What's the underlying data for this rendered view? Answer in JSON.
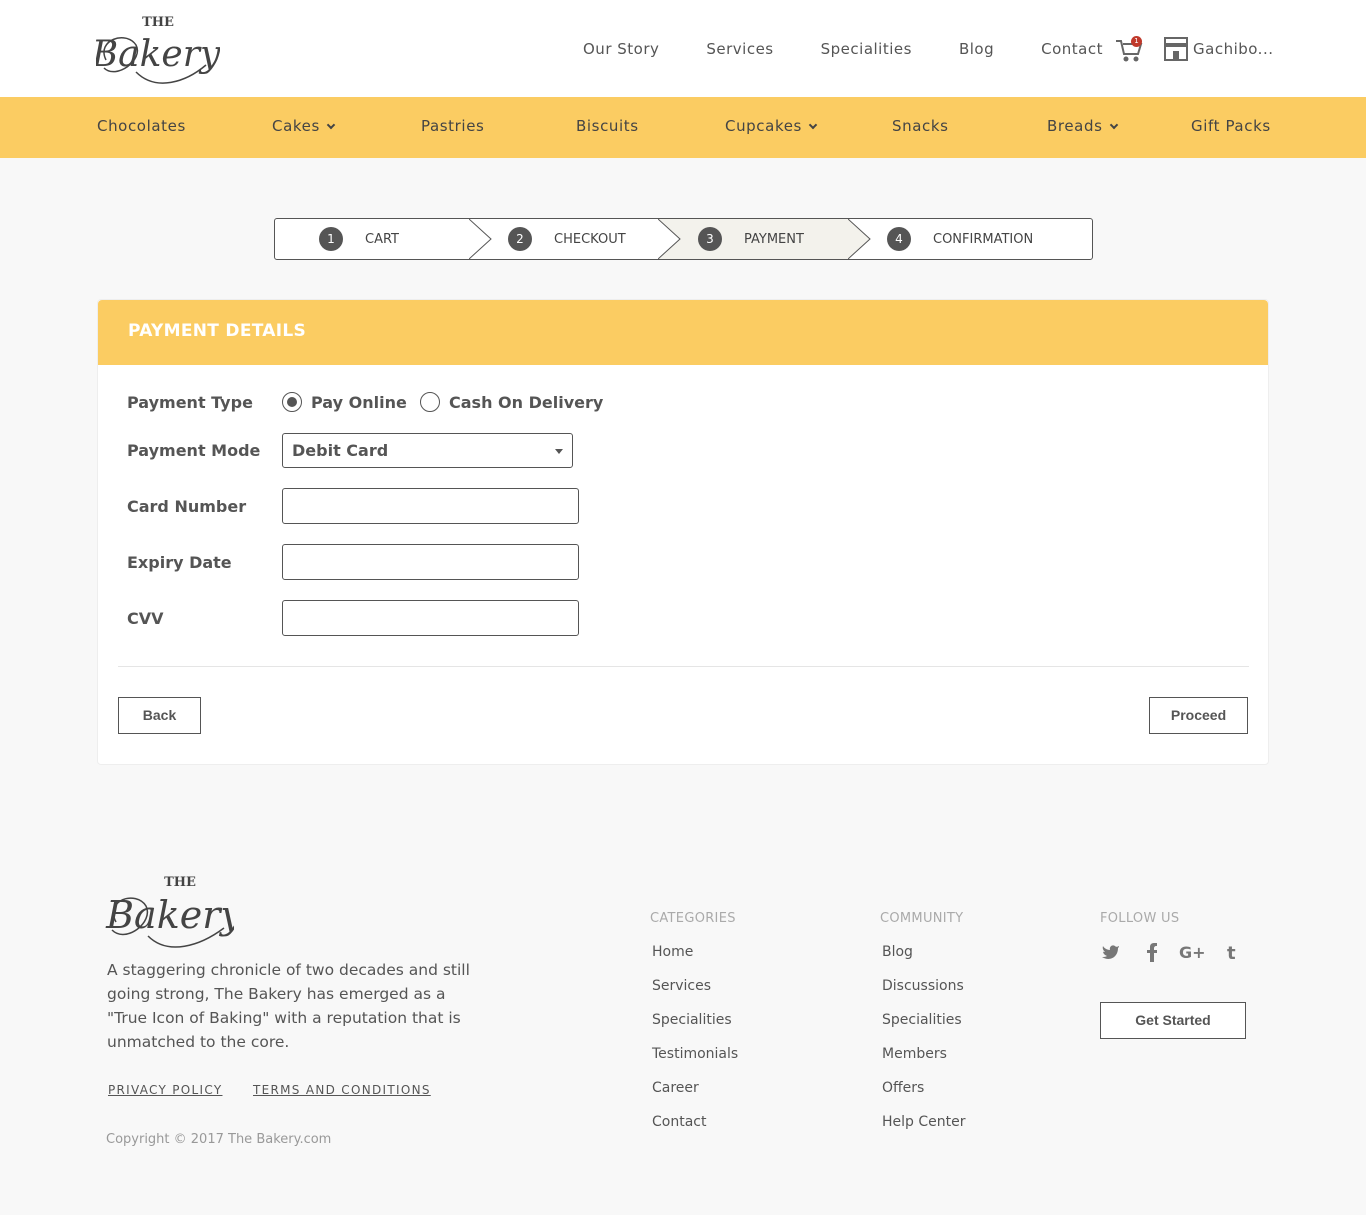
{
  "header": {
    "logo_text": "The Bakery",
    "nav": [
      "Our Story",
      "Services",
      "Specialities",
      "Blog",
      "Contact"
    ],
    "cart_count": "1",
    "store_label": "Gachibo..."
  },
  "categories": [
    {
      "label": "Chocolates"
    },
    {
      "label": "Cakes"
    },
    {
      "label": "Pastries"
    },
    {
      "label": "Biscuits"
    },
    {
      "label": "Cupcakes"
    },
    {
      "label": "Snacks"
    },
    {
      "label": "Breads"
    },
    {
      "label": "Gift Packs"
    }
  ],
  "stepper": {
    "steps": [
      {
        "num": "1",
        "label": "CART"
      },
      {
        "num": "2",
        "label": "CHECKOUT"
      },
      {
        "num": "3",
        "label": "PAYMENT"
      },
      {
        "num": "4",
        "label": "CONFIRMATION"
      }
    ],
    "active": "PAYMENT"
  },
  "payment": {
    "title": "PAYMENT DETAILS",
    "type_label": "Payment Type",
    "options": [
      "Pay Online",
      "Cash On Delivery"
    ],
    "selected_option": "Pay Online",
    "mode_label": "Payment Mode",
    "mode_value": "Debit Card",
    "card_number_label": "Card Number",
    "card_number_value": "",
    "expiry_label": "Expiry Date",
    "expiry_value": "",
    "cvv_label": "CVV",
    "cvv_value": "",
    "back_label": "Back",
    "proceed_label": "Proceed"
  },
  "footer": {
    "logo_text": "The Bakery",
    "description": "A staggering chronicle of two decades and still going strong, The Bakery has emerged as a \"True Icon of Baking\" with a reputation that is unmatched to the core.",
    "privacy": "PRIVACY POLICY",
    "terms": "TERMS AND CONDITIONS",
    "copyright": "Copyright © 2017 The Bakery.com",
    "categories_title": "CATEGORIES",
    "categories_links": [
      "Home",
      "Services",
      "Specialities",
      "Testimonials",
      "Career",
      "Contact"
    ],
    "community_title": "COMMUNITY",
    "community_links": [
      "Blog",
      "Discussions",
      "Specialities",
      "Members",
      "Offers",
      "Help Center"
    ],
    "follow_title": "FOLLOW US",
    "social": [
      "twitter-icon",
      "facebook-icon",
      "google-plus-icon",
      "tumblr-icon"
    ],
    "get_started": "Get Started"
  },
  "colors": {
    "accent": "#fbcc62",
    "text": "#555555",
    "badge": "#c0392b"
  }
}
